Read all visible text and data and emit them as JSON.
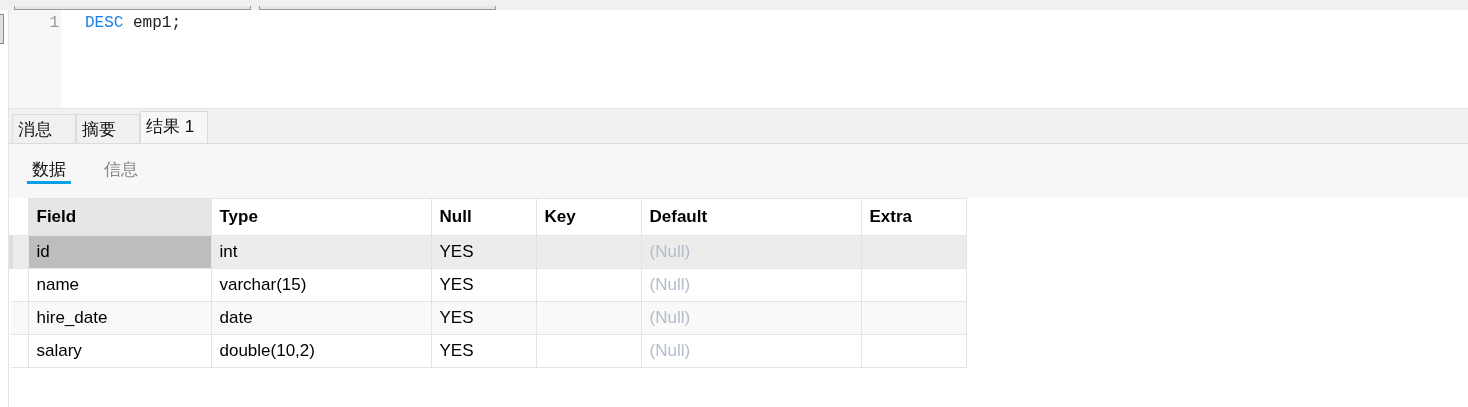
{
  "editor": {
    "lines": [
      {
        "number": "1",
        "tokens": [
          {
            "kind": "keyword",
            "text": "DESC"
          },
          {
            "kind": "plain",
            "text": "emp1;"
          }
        ]
      }
    ]
  },
  "result_tabs": [
    {
      "label": "消息",
      "selected": false
    },
    {
      "label": "摘要",
      "selected": false
    },
    {
      "label": "结果 1",
      "selected": true
    }
  ],
  "view_tabs": [
    {
      "label": "数据",
      "selected": true
    },
    {
      "label": "信息",
      "selected": false
    }
  ],
  "table": {
    "columns": [
      "Field",
      "Type",
      "Null",
      "Key",
      "Default",
      "Extra"
    ],
    "rows": [
      {
        "selected": true,
        "cells": [
          {
            "kind": "value",
            "text": "id"
          },
          {
            "kind": "value",
            "text": "int"
          },
          {
            "kind": "value",
            "text": "YES"
          },
          {
            "kind": "empty"
          },
          {
            "kind": "null",
            "text": "(Null)"
          },
          {
            "kind": "empty"
          }
        ]
      },
      {
        "selected": false,
        "cells": [
          {
            "kind": "value",
            "text": "name"
          },
          {
            "kind": "value",
            "text": "varchar(15)"
          },
          {
            "kind": "value",
            "text": "YES"
          },
          {
            "kind": "empty"
          },
          {
            "kind": "null",
            "text": "(Null)"
          },
          {
            "kind": "empty"
          }
        ]
      },
      {
        "selected": false,
        "cells": [
          {
            "kind": "value",
            "text": "hire_date"
          },
          {
            "kind": "value",
            "text": "date"
          },
          {
            "kind": "value",
            "text": "YES"
          },
          {
            "kind": "empty"
          },
          {
            "kind": "null",
            "text": "(Null)"
          },
          {
            "kind": "empty"
          }
        ]
      },
      {
        "selected": false,
        "cells": [
          {
            "kind": "value",
            "text": "salary"
          },
          {
            "kind": "value",
            "text": "double(10,2)"
          },
          {
            "kind": "value",
            "text": "YES"
          },
          {
            "kind": "empty"
          },
          {
            "kind": "null",
            "text": "(Null)"
          },
          {
            "kind": "empty"
          }
        ]
      }
    ]
  }
}
